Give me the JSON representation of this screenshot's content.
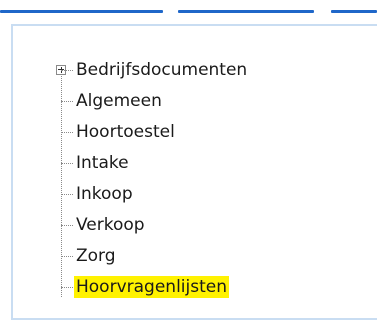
{
  "colors": {
    "tab_line": "#1f67c9",
    "frame_border": "#c9ddf2",
    "highlight": "#fff200"
  },
  "tree": {
    "items": [
      {
        "label": "Bedrijfsdocumenten",
        "expandable": true,
        "highlighted": false
      },
      {
        "label": "Algemeen",
        "expandable": false,
        "highlighted": false
      },
      {
        "label": "Hoortoestel",
        "expandable": false,
        "highlighted": false
      },
      {
        "label": "Intake",
        "expandable": false,
        "highlighted": false
      },
      {
        "label": "Inkoop",
        "expandable": false,
        "highlighted": false
      },
      {
        "label": "Verkoop",
        "expandable": false,
        "highlighted": false
      },
      {
        "label": "Zorg",
        "expandable": false,
        "highlighted": false
      },
      {
        "label": "Hoorvragenlijsten",
        "expandable": false,
        "highlighted": true
      }
    ]
  }
}
